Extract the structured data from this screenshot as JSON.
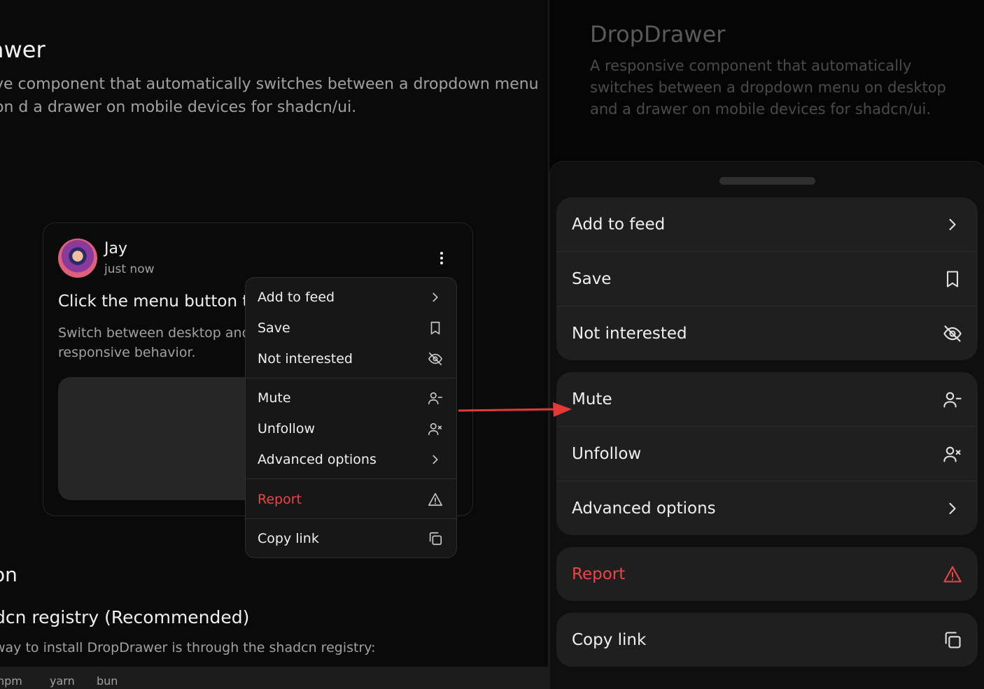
{
  "desktop": {
    "title": "awer",
    "description": "ve component that automatically switches between a dropdown menu on d a drawer on mobile devices for shadcn/ui.",
    "post": {
      "user_name": "Jay",
      "timestamp": "just now",
      "title": "Click the menu button to",
      "description": "Switch between desktop and responsive behavior."
    },
    "menu": {
      "items": [
        {
          "label": "Add to feed",
          "icon": "chevron-right-icon"
        },
        {
          "label": "Save",
          "icon": "bookmark-icon"
        },
        {
          "label": "Not interested",
          "icon": "eye-off-icon"
        },
        {
          "label": "Mute",
          "icon": "user-minus-icon"
        },
        {
          "label": "Unfollow",
          "icon": "user-x-icon"
        },
        {
          "label": "Advanced options",
          "icon": "chevron-right-icon"
        },
        {
          "label": "Report",
          "icon": "alert-triangle-icon",
          "color": "#ef4444"
        },
        {
          "label": "Copy link",
          "icon": "copy-icon"
        }
      ]
    },
    "section_heading": "on",
    "subheading": "dcn registry (Recommended)",
    "paragraph": "way to install DropDrawer is through the shadcn registry:",
    "tabs": [
      "npm",
      "yarn",
      "bun"
    ]
  },
  "mobile": {
    "title": "DropDrawer",
    "description": "A responsive component that automatically switches between a dropdown menu on desktop and a drawer on mobile devices for shadcn/ui.",
    "groups": [
      [
        {
          "label": "Add to feed",
          "icon": "chevron-right-icon"
        },
        {
          "label": "Save",
          "icon": "bookmark-icon"
        },
        {
          "label": "Not interested",
          "icon": "eye-off-icon"
        }
      ],
      [
        {
          "label": "Mute",
          "icon": "user-minus-icon"
        },
        {
          "label": "Unfollow",
          "icon": "user-x-icon"
        },
        {
          "label": "Advanced options",
          "icon": "chevron-right-icon"
        }
      ],
      [
        {
          "label": "Report",
          "icon": "alert-triangle-icon",
          "color": "#ef4444"
        }
      ],
      [
        {
          "label": "Copy link",
          "icon": "copy-icon"
        }
      ]
    ]
  },
  "colors": {
    "background": "#0a0a0a",
    "menu_bg": "#171717",
    "drawer_item_bg": "#1f1f1f",
    "danger": "#ef4444",
    "arrow": "#e53935"
  }
}
